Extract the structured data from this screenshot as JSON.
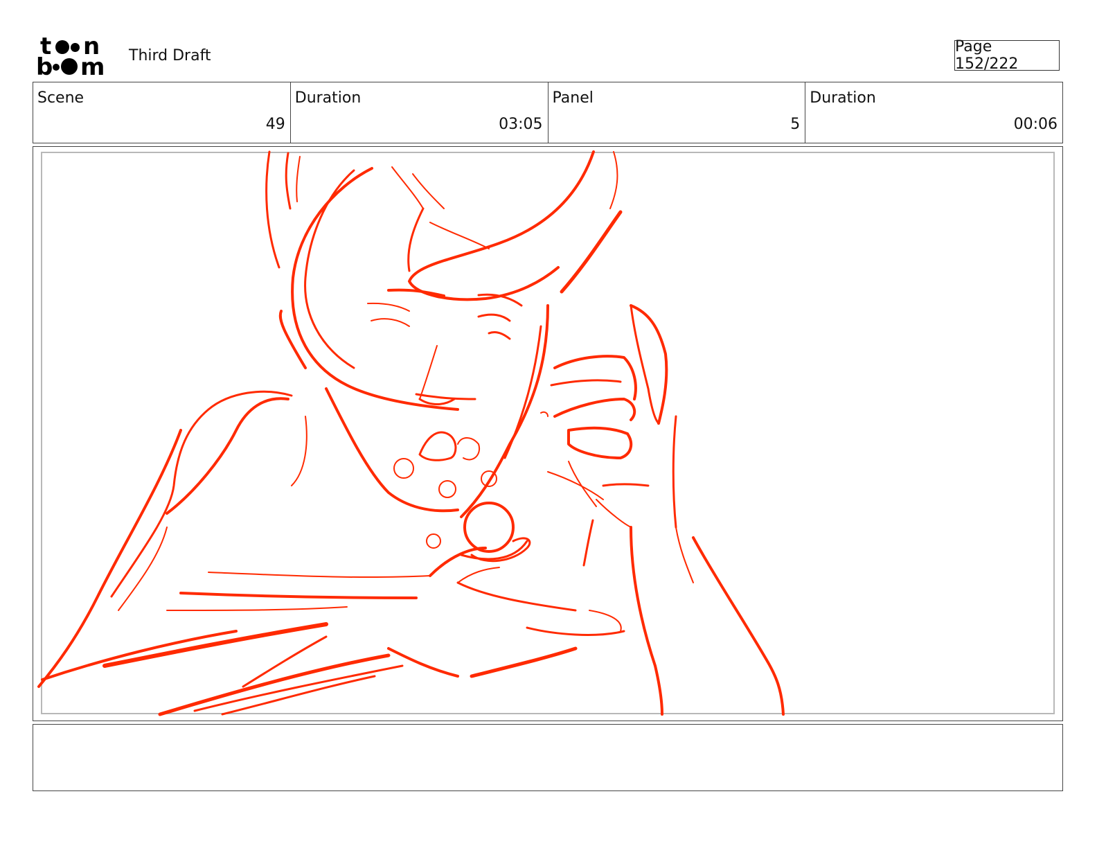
{
  "header": {
    "logo": {
      "line1": "toon",
      "line2": "boom"
    },
    "title": "Third Draft",
    "page_label": "Page 152/222"
  },
  "info": [
    {
      "label": "Scene",
      "value": "49"
    },
    {
      "label": "Duration",
      "value": "03:05"
    },
    {
      "label": "Panel",
      "value": "5"
    },
    {
      "label": "Duration",
      "value": "00:06"
    }
  ],
  "panel": {
    "stroke_color": "#ff2a00"
  },
  "notes": {
    "text": ""
  }
}
